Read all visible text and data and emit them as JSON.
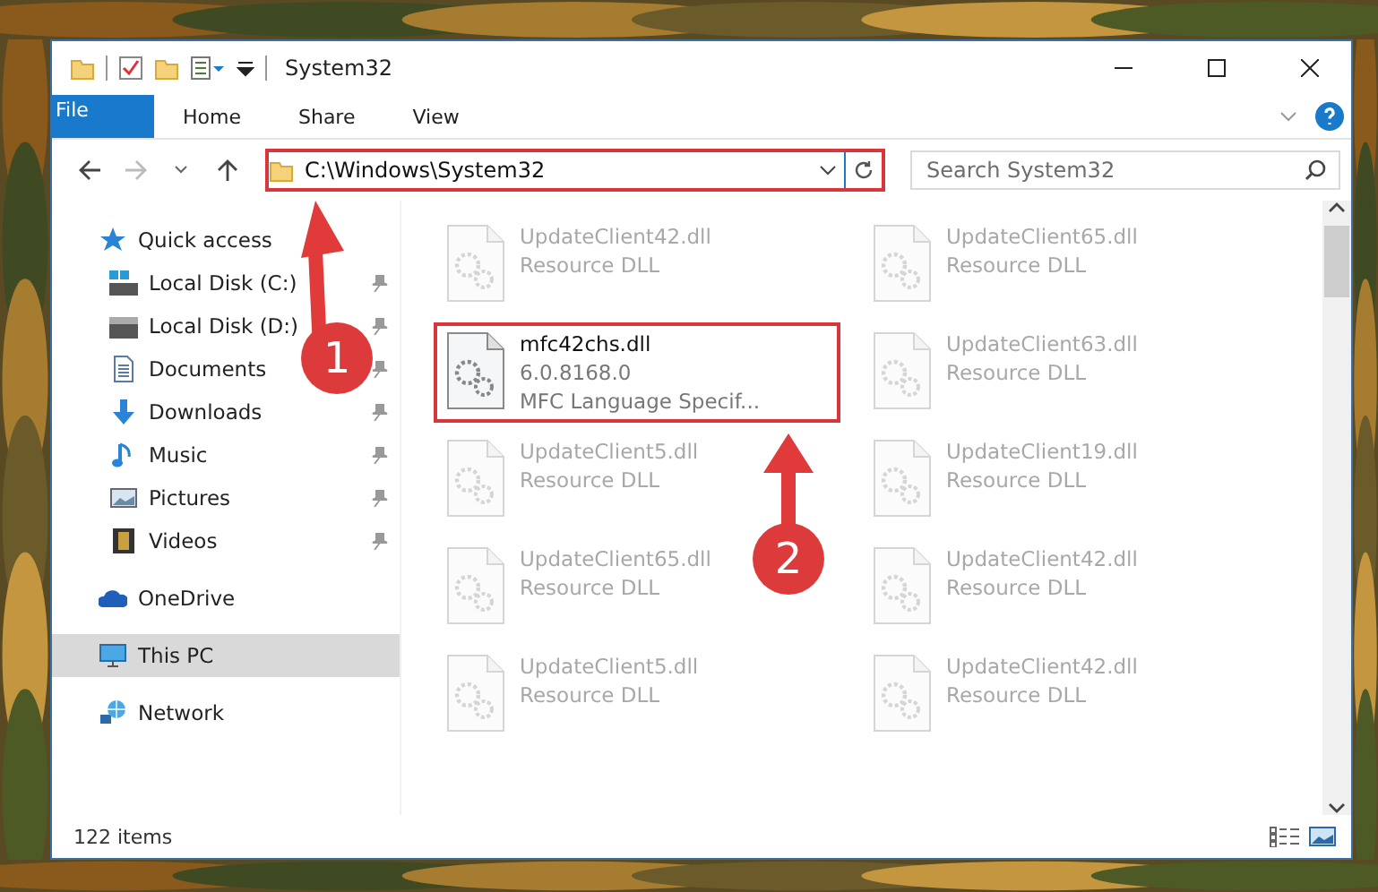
{
  "window": {
    "title": "System32"
  },
  "ribbon_tabs": [
    {
      "label": "File",
      "kind": "file",
      "selected": false
    },
    {
      "label": "Home",
      "kind": "tab",
      "selected": false
    },
    {
      "label": "Share",
      "kind": "tab",
      "selected": false
    },
    {
      "label": "View",
      "kind": "tab",
      "selected": false
    }
  ],
  "address": {
    "path": "C:\\Windows\\System32"
  },
  "search": {
    "placeholder": "Search System32"
  },
  "sidebar": {
    "items": [
      {
        "label": "Quick access",
        "kind": "quick",
        "selected": false,
        "children": [
          {
            "label": "Local Disk (C:)",
            "kind": "diskc",
            "pinned": true,
            "selected": false
          },
          {
            "label": "Local Disk (D:)",
            "kind": "disk",
            "pinned": true,
            "selected": false
          },
          {
            "label": "Documents",
            "kind": "documents",
            "pinned": true,
            "selected": false
          },
          {
            "label": "Downloads",
            "kind": "downloads",
            "pinned": true,
            "selected": false
          },
          {
            "label": "Music",
            "kind": "music",
            "pinned": true,
            "selected": false
          },
          {
            "label": "Pictures",
            "kind": "pictures",
            "pinned": true,
            "selected": false
          },
          {
            "label": "Videos",
            "kind": "videos",
            "pinned": true,
            "selected": false
          }
        ]
      },
      {
        "label": "OneDrive",
        "kind": "onedrive",
        "selected": false
      },
      {
        "label": "This PC",
        "kind": "pc",
        "selected": true
      },
      {
        "label": "Network",
        "kind": "network",
        "selected": false
      }
    ]
  },
  "files": [
    {
      "name": "UpdateClient42.dll",
      "lines": [
        "Resource DLL"
      ],
      "dimmed": true
    },
    {
      "name": "UpdateClient65.dll",
      "lines": [
        "Resource DLL"
      ],
      "dimmed": true
    },
    {
      "name": "mfc42chs.dll",
      "lines": [
        "6.0.8168.0",
        "MFC Language Specif..."
      ],
      "dimmed": false,
      "highlighted": true
    },
    {
      "name": "UpdateClient63.dll",
      "lines": [
        "Resource DLL"
      ],
      "dimmed": true
    },
    {
      "name": "UpdateClient5.dll",
      "lines": [
        "Resource DLL"
      ],
      "dimmed": true
    },
    {
      "name": "UpdateClient19.dll",
      "lines": [
        "Resource DLL"
      ],
      "dimmed": true
    },
    {
      "name": "UpdateClient65.dll",
      "lines": [
        "Resource DLL"
      ],
      "dimmed": true
    },
    {
      "name": "UpdateClient42.dll",
      "lines": [
        "Resource DLL"
      ],
      "dimmed": true
    },
    {
      "name": "UpdateClient5.dll",
      "lines": [
        "Resource DLL"
      ],
      "dimmed": true
    },
    {
      "name": "UpdateClient42.dll",
      "lines": [
        "Resource DLL"
      ],
      "dimmed": true
    }
  ],
  "status_bar": {
    "item_count": "122 items"
  },
  "annotations": [
    {
      "label": "1"
    },
    {
      "label": "2"
    }
  ]
}
